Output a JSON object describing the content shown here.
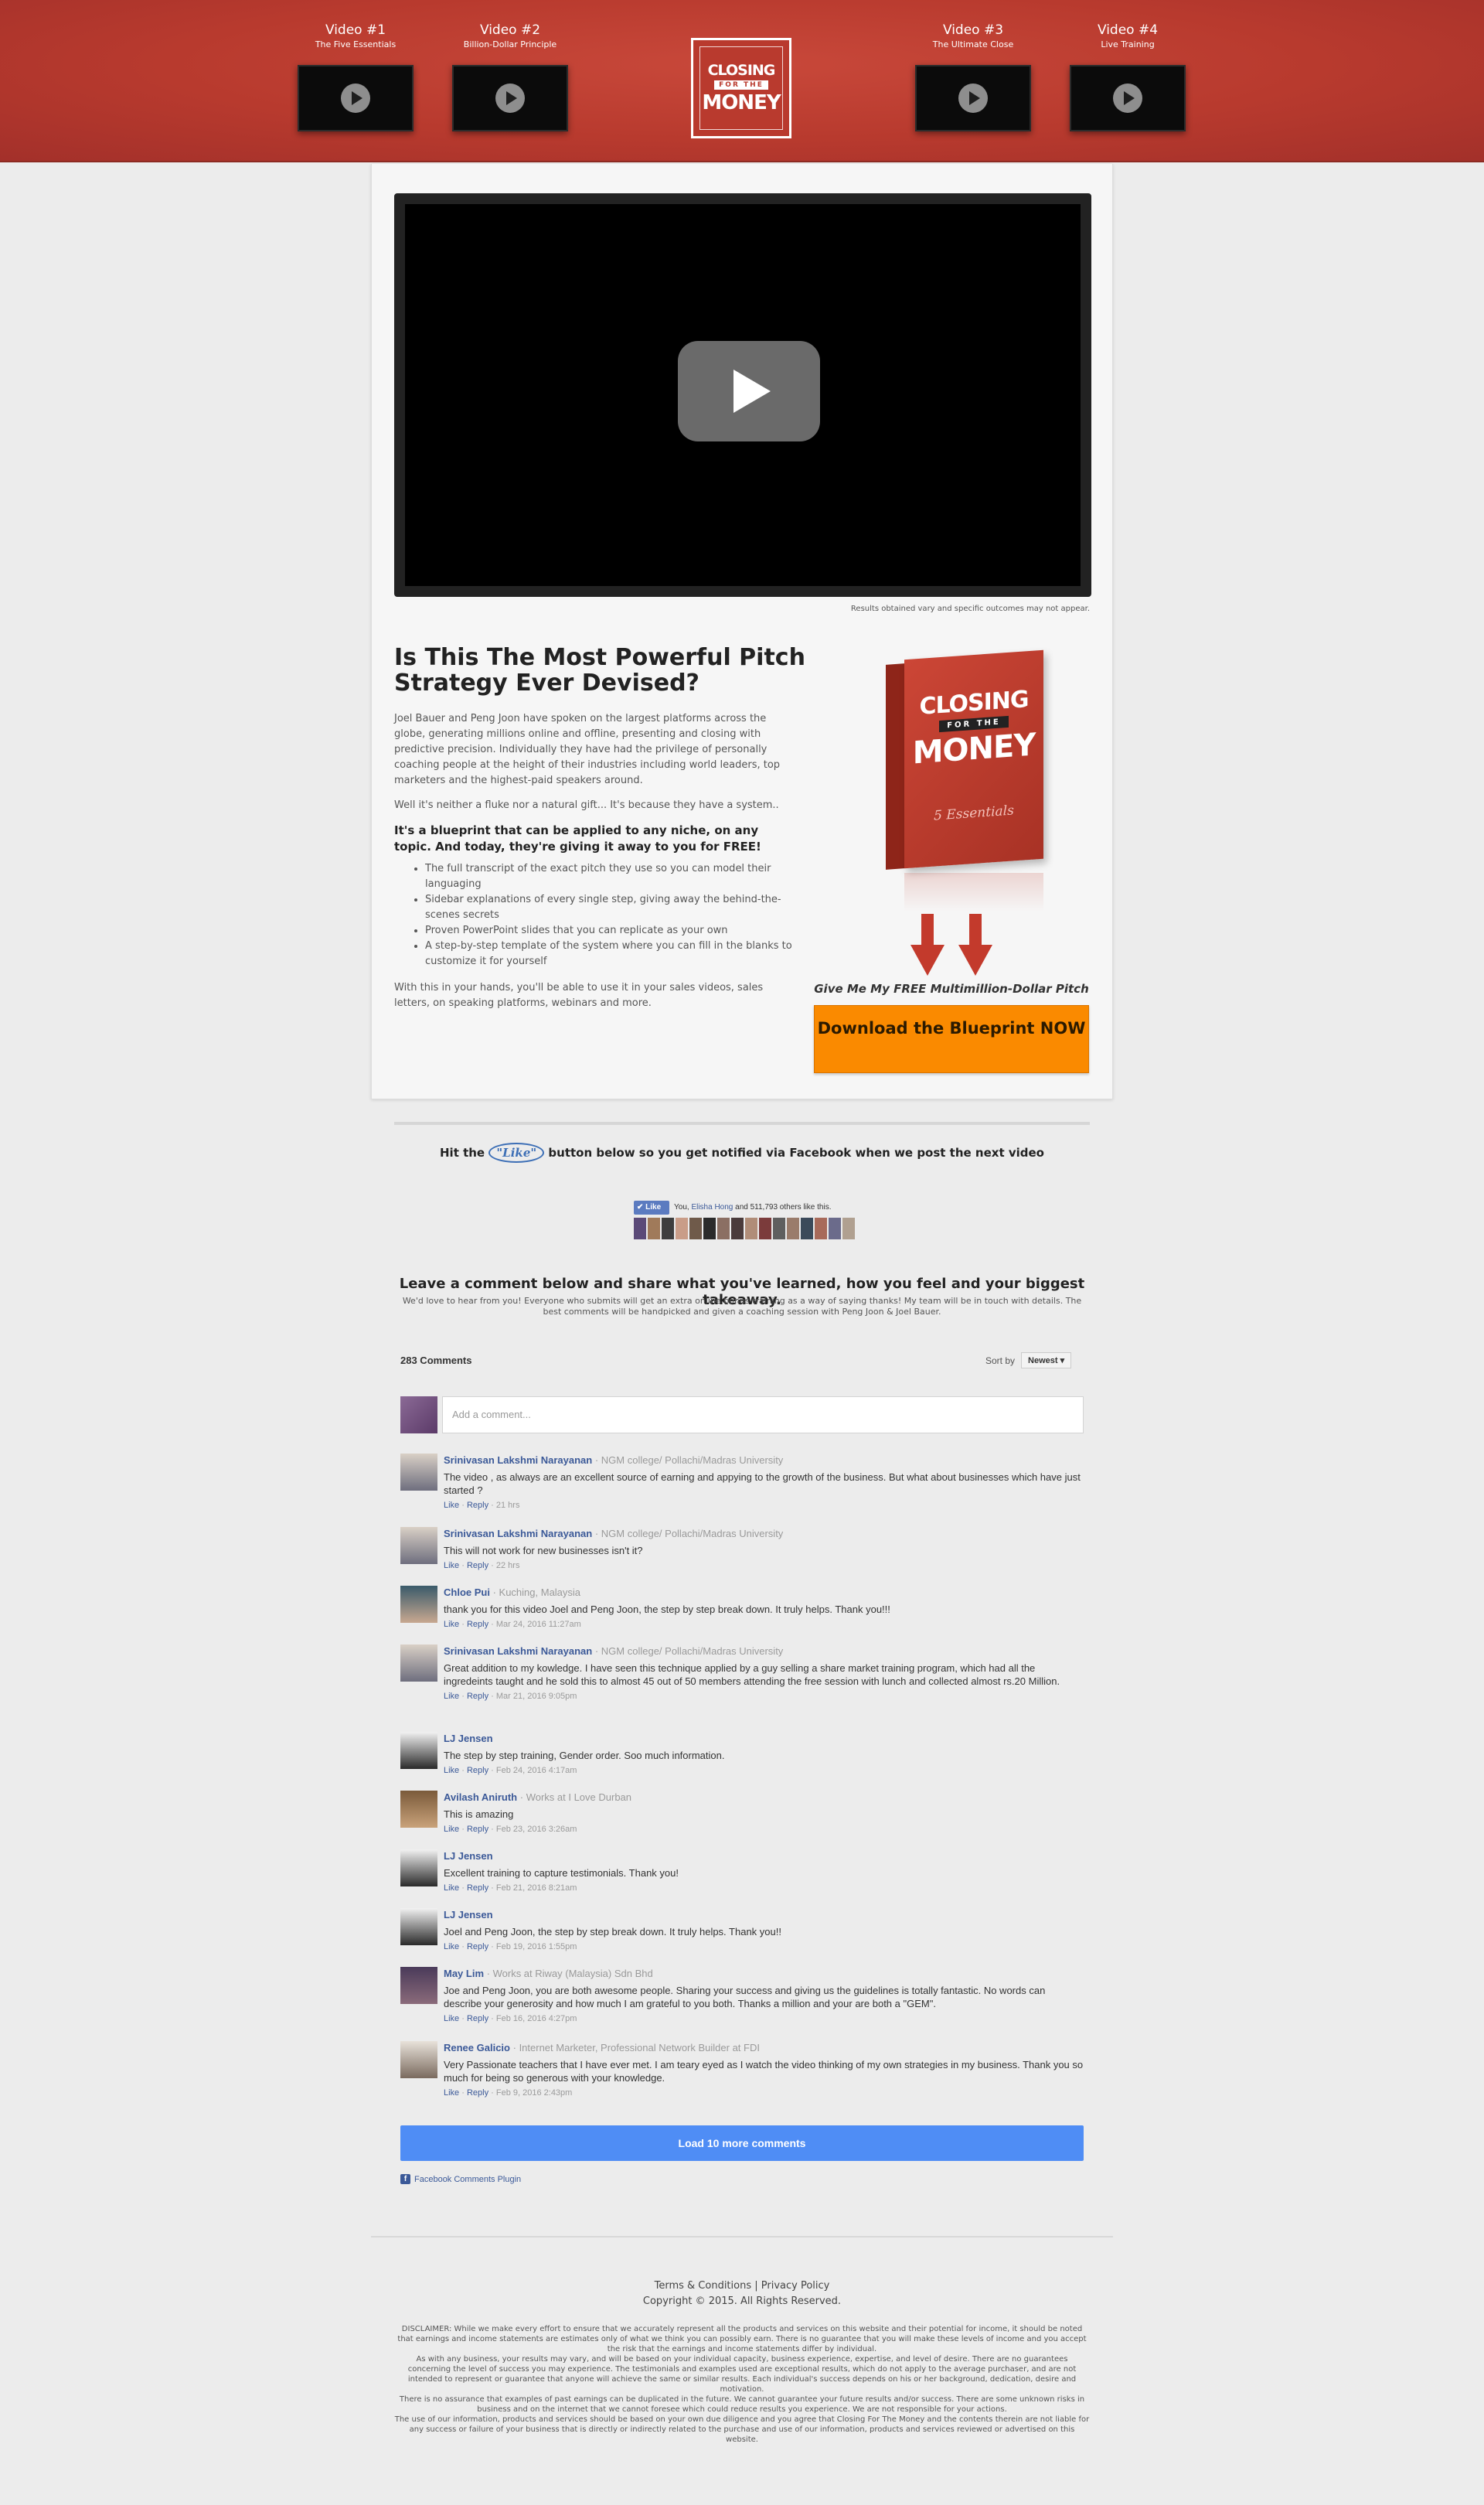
{
  "header": {
    "videos_left": [
      {
        "title": "Video #1",
        "subtitle": "The Five Essentials"
      },
      {
        "title": "Video #2",
        "subtitle": "Billion-Dollar Principle"
      }
    ],
    "videos_right": [
      {
        "title": "Video #3",
        "subtitle": "The Ultimate Close"
      },
      {
        "title": "Video #4",
        "subtitle": "Live Training"
      }
    ],
    "logo": {
      "line1": "CLOSING",
      "line2": "FOR THE",
      "line3": "MONEY"
    }
  },
  "main": {
    "results_note": "Results obtained vary and specific outcomes may not appear.",
    "title": "Is This The Most Powerful Pitch Strategy Ever Devised?",
    "para1": "Joel Bauer and Peng Joon have spoken on the largest platforms across the globe, generating millions online and offline, presenting and closing with predictive precision. Individually they have had the privilege of personally coaching people at the height of their industries including world leaders, top marketers and the highest-paid speakers around.",
    "para2": "Well it's neither a fluke nor a natural gift... It's because they have a system..",
    "bold_line": "It's a blueprint that can be applied to any niche, on any topic. And today, they're giving it away to you for FREE!",
    "bullets": [
      "The full transcript of the exact pitch they use so you can model their languaging",
      "Sidebar explanations of every single step, giving away the behind-the-scenes secrets",
      "Proven PowerPoint slides that you can replicate as your own",
      "A step-by-step template of the system where you can fill in the blanks to customize it for yourself"
    ],
    "para3": "With this in your hands, you'll be able to use it in your sales videos, sales letters, on speaking platforms, webinars and more.",
    "book": {
      "line1": "CLOSING",
      "line2": "FOR THE",
      "line3": "MONEY",
      "subtitle": "5 Essentials",
      "spine": "5 Essentials"
    },
    "give_me": "Give Me My FREE Multimillion-Dollar Pitch",
    "download_button": "Download the Blueprint NOW"
  },
  "like_section": {
    "hit_before": "Hit the",
    "like_word": "\"Like\"",
    "hit_after": "button below so you get notified via Facebook when we post the next video",
    "fb_button": "Like",
    "fb_text_prefix": "You,",
    "fb_text_name": "Elisha Hong",
    "fb_text_suffix": "and 511,793 others like this."
  },
  "leave_comment": {
    "heading": "Leave a comment below and share what you've learned, how you feel and your biggest takeaway.",
    "sub": "We'd love to hear from you! Everyone who submits will get an extra online bonus training as a way of saying thanks! My team will be in touch with details. The best comments will be handpicked and given a coaching session with Peng Joon & Joel Bauer."
  },
  "comments_plugin": {
    "count": "283 Comments",
    "sort_label": "Sort by",
    "sort_value": "Newest",
    "placeholder": "Add a comment...",
    "comments": [
      {
        "name": "Srinivasan Lakshmi Narayanan",
        "meta": "NGM college/ Pollachi/Madras University",
        "text": "The video , as always are an excellent source of earning and appying to the growth of the business. But what about businesses which have just started ?",
        "time": "21 hrs"
      },
      {
        "name": "Srinivasan Lakshmi Narayanan",
        "meta": "NGM college/ Pollachi/Madras University",
        "text": "This will not work for new businesses isn't it?",
        "time": "22 hrs"
      },
      {
        "name": "Chloe Pui",
        "meta": "Kuching, Malaysia",
        "text": "thank you for this video Joel and Peng Joon, the step by step break down. It truly helps. Thank you!!!",
        "time": "Mar 24, 2016 11:27am"
      },
      {
        "name": "Srinivasan Lakshmi Narayanan",
        "meta": "NGM college/ Pollachi/Madras University",
        "text": "Great addition to my kowledge. I have seen this technique applied by a guy selling a share market training program, which had all the ingredeints taught and he sold this to almost 45 out of 50 members attending the free session with lunch and collected almost rs.20 Million.",
        "time": "Mar 21, 2016 9:05pm"
      },
      {
        "name": "LJ Jensen",
        "meta": "",
        "text": "The step by step training, Gender order. Soo much information.",
        "time": "Feb 24, 2016 4:17am"
      },
      {
        "name": "Avilash Aniruth",
        "meta": "Works at I Love Durban",
        "text": "This is amazing",
        "time": "Feb 23, 2016 3:26am"
      },
      {
        "name": "LJ Jensen",
        "meta": "",
        "text": "Excellent training to capture testimonials. Thank you!",
        "time": "Feb 21, 2016 8:21am"
      },
      {
        "name": "LJ Jensen",
        "meta": "",
        "text": "Joel and Peng Joon, the step by step break down. It truly helps. Thank you!!",
        "time": "Feb 19, 2016 1:55pm"
      },
      {
        "name": "May Lim",
        "meta": "Works at Riway (Malaysia) Sdn Bhd",
        "text": "Joe and Peng Joon, you are both awesome people. Sharing your success and giving us the guidelines is totally fantastic. No words can describe your generosity and how much I am grateful to you both. Thanks a million and your are both a \"GEM\".",
        "time": "Feb 16, 2016 4:27pm"
      },
      {
        "name": "Renee Galicio",
        "meta": "Internet Marketer, Professional Network Builder at FDI",
        "text": "Very Passionate teachers that I have ever met. I am teary eyed as I watch the video thinking of my own strategies in my business. Thank you so much for being so generous with your knowledge.",
        "time": "Feb 9, 2016 2:43pm"
      }
    ],
    "action_like": "Like",
    "action_reply": "Reply",
    "load_more": "Load 10 more comments",
    "plugin_label": "Facebook Comments Plugin"
  },
  "footer": {
    "terms": "Terms & Conditions",
    "privacy": "Privacy Policy",
    "divider": "|",
    "copyright": "Copyright © 2015. All Rights Reserved.",
    "disclaimer": [
      "DISCLAIMER: While we make every effort to ensure that we accurately represent all the products and services on this website and their potential for income, it should be noted that earnings and income statements are estimates only of what we think you can possibly earn. There is no guarantee that you will make these levels of income and you accept the risk that the earnings and income statements differ by individual.",
      "As with any business, your results may vary, and will be based on your individual capacity, business experience, expertise, and level of desire. There are no guarantees concerning the level of success you may experience. The testimonials and examples used are exceptional results, which do not apply to the average purchaser, and are not intended to represent or guarantee that anyone will achieve the same or similar results. Each individual's success depends on his or her background, dedication, desire and motivation.",
      "There is no assurance that examples of past earnings can be duplicated in the future. We cannot guarantee your future results and/or success. There are some unknown risks in business and on the internet that we cannot foresee which could reduce results you experience. We are not responsible for your actions.",
      "The use of our information, products and services should be based on your own due diligence and you agree that Closing For The Money and the contents therein are not liable for any success or failure of your business that is directly or indirectly related to the purchase and use of our information, products and services reviewed or advertised on this website."
    ]
  },
  "colors": {
    "header_red": "#b83a2e",
    "cta_orange": "#fa8a00",
    "fb_blue": "#4f8df5",
    "fb_link": "#3b5998"
  }
}
